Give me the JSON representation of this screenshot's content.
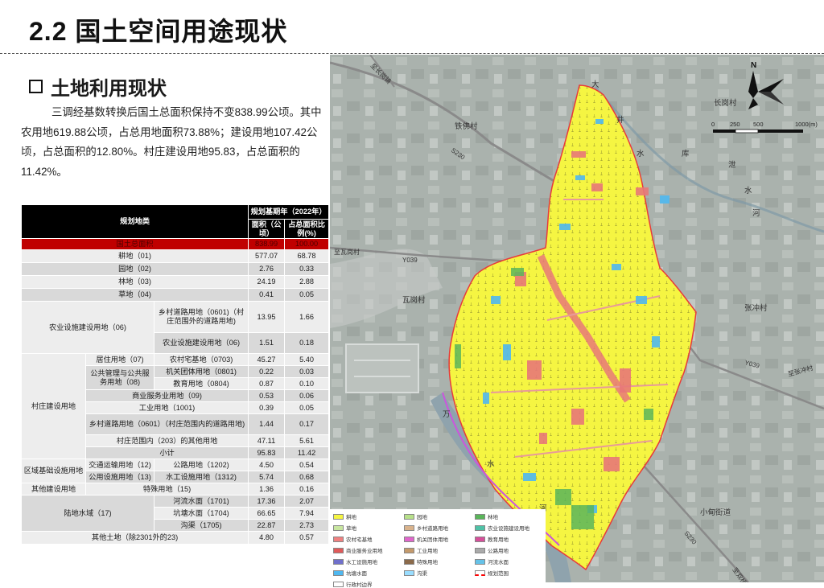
{
  "page": {
    "title": "2.2 国土空间用途现状",
    "section": "土地利用现状"
  },
  "intro": "三调经基数转换后国土总面积保持不变838.99公顷。其中农用地619.88公顷，占总用地面积73.88%；建设用地107.42公顷，占总面积的12.80%。村庄建设用地95.83，占总面积的11.42%。",
  "table": {
    "h_category": "规划地类",
    "h_year": "规划基期年（2022年）",
    "h_area": "面积（公顷）",
    "h_pct": "占总面积比例(%)",
    "total": {
      "label": "国土总面积",
      "area": "838.99",
      "pct": "100.00"
    },
    "r_arable": {
      "label": "耕地（01)",
      "area": "577.07",
      "pct": "68.78"
    },
    "r_garden": {
      "label": "园地（02)",
      "area": "2.76",
      "pct": "0.33"
    },
    "r_forest": {
      "label": "林地（03)",
      "area": "24.19",
      "pct": "2.88"
    },
    "r_grass": {
      "label": "草地（04)",
      "area": "0.41",
      "pct": "0.05"
    },
    "agri_fac": {
      "label": "农业设施建设用地（06)",
      "road_label": "乡村道路用地（0601)（村庄范围外的道路用地)",
      "road_area": "13.95",
      "road_pct": "1.66",
      "fac_label": "农业设施建设用地（06)",
      "fac_area": "1.51",
      "fac_pct": "0.18"
    },
    "village": {
      "label": "村庄建设用地",
      "residential": "居住用地（07)",
      "homestead": {
        "label": "农村宅基地（0703)",
        "area": "45.27",
        "pct": "5.40"
      },
      "public_group": "公共管理与公共服务用地（08)",
      "org": {
        "label": "机关团体用地（0801)",
        "area": "0.22",
        "pct": "0.03"
      },
      "edu": {
        "label": "教育用地（0804)",
        "area": "0.87",
        "pct": "0.10"
      },
      "commerce": {
        "label": "商业服务业用地（09)",
        "area": "0.53",
        "pct": "0.06"
      },
      "industry": {
        "label": "工业用地（1001)",
        "area": "0.39",
        "pct": "0.05"
      },
      "road": {
        "label": "乡村道路用地（0601）（村庄范围内的道路用地)",
        "area": "1.44",
        "pct": "0.17"
      },
      "other": {
        "label": "村庄范围内（203）的其他用地",
        "area": "47.11",
        "pct": "5.61"
      },
      "subtotal": {
        "label": "小计",
        "area": "95.83",
        "pct": "11.42"
      }
    },
    "regional": {
      "label": "区域基础设施用地",
      "transport": "交通运输用地（12)",
      "highway": {
        "label": "公路用地（1202)",
        "area": "4.50",
        "pct": "0.54"
      },
      "utility": "公用设施用地（13)",
      "hydro": {
        "label": "水工设施用地（1312)",
        "area": "5.74",
        "pct": "0.68"
      }
    },
    "other_build": {
      "label": "其他建设用地",
      "special": "特殊用地（15)",
      "area": "1.36",
      "pct": "0.16"
    },
    "water": {
      "label": "陆地水域（17)",
      "river": {
        "label": "河流水面（1701)",
        "area": "17.36",
        "pct": "2.07"
      },
      "pond": {
        "label": "坑塘水面（1704)",
        "area": "66.65",
        "pct": "7.94"
      },
      "ditch": {
        "label": "沟渠（1705)",
        "area": "22.87",
        "pct": "2.73"
      }
    },
    "other_land": {
      "label": "其他土地（除2301外的23)",
      "area": "4.80",
      "pct": "0.57"
    }
  },
  "map": {
    "north": "N",
    "scale": {
      "t0": "0",
      "t1": "250",
      "t2": "500",
      "t3": "1000(m)"
    },
    "labels": {
      "changgang": "长岗村",
      "tiefo": "铁佛村",
      "wagang": "瓦岗村",
      "zhangchong": "张冲村",
      "xiaodian": "小甸街道",
      "toZhangchong": "至张冲村",
      "toWagang": "至瓦岗村",
      "toGangji": "至长岗镇",
      "toSouth": "至双桥镇",
      "s230a": "S230",
      "s230b": "S230",
      "y039a": "Y039",
      "y039b": "Y039",
      "river1": "大",
      "river2": "井",
      "river3": "水",
      "river4": "库",
      "river5": "泄",
      "river6": "水",
      "river7": "河",
      "wan": "万",
      "shui": "水",
      "he": "河"
    },
    "legend": [
      {
        "label": "耕地",
        "color": "#f5f542"
      },
      {
        "label": "园地",
        "color": "#b7e08a"
      },
      {
        "label": "林地",
        "color": "#5ab55a"
      },
      {
        "label": "草地",
        "color": "#c8e6a0"
      },
      {
        "label": "乡村道路用地",
        "color": "#d9b38c"
      },
      {
        "label": "农业设施建设用地",
        "color": "#4fc1a6"
      },
      {
        "label": "农村宅基地",
        "color": "#f08080"
      },
      {
        "label": "机关团体用地",
        "color": "#e066cc"
      },
      {
        "label": "教育用地",
        "color": "#d64f9a"
      },
      {
        "label": "商业服务业用地",
        "color": "#e05a5a"
      },
      {
        "label": "工业用地",
        "color": "#c49a6c"
      },
      {
        "label": "公路用地",
        "color": "#aaaaaa"
      },
      {
        "label": "水工设施用地",
        "color": "#7070cc"
      },
      {
        "label": "特殊用地",
        "color": "#8b6a4a"
      },
      {
        "label": "河流水面",
        "color": "#66c2e8"
      },
      {
        "label": "坑塘水面",
        "color": "#4fb8f0"
      },
      {
        "label": "沟渠",
        "color": "#99ddff"
      },
      {
        "label": "规划范围",
        "color": "#ff0000"
      },
      {
        "label": "行政村边界",
        "color": "#ffffff"
      }
    ]
  }
}
